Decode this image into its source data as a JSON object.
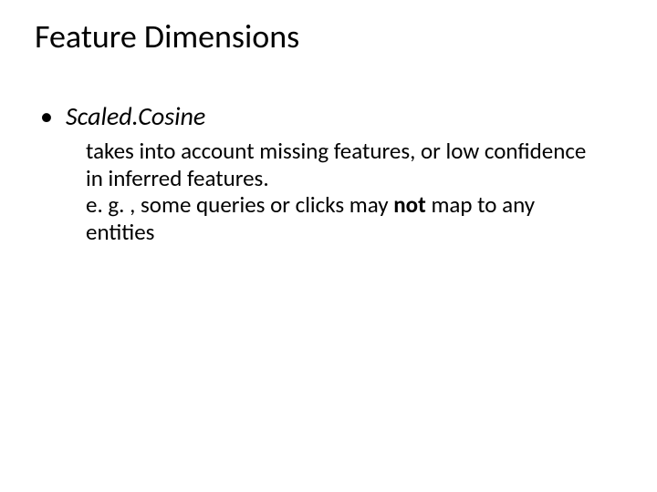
{
  "title": "Feature Dimensions",
  "bullet": {
    "marker": "•",
    "label": "Scaled.Cosine"
  },
  "sub": {
    "line1": "takes into account missing features, or low confidence in inferred features.",
    "line2_pre": "e. g. , some queries or clicks may ",
    "line2_bold": "not",
    "line2_post": " map to any entities"
  }
}
